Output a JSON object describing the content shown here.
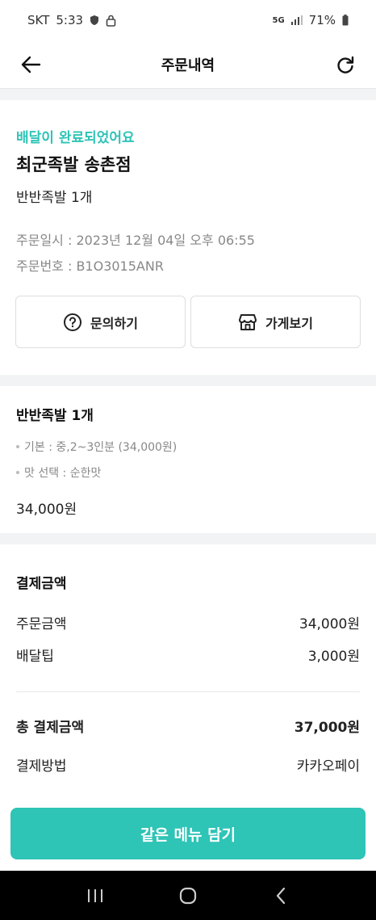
{
  "status_bar": {
    "carrier": "SKT",
    "time": "5:33",
    "network": "5G",
    "battery": "71%"
  },
  "app_bar": {
    "title": "주문내역",
    "back_icon": "arrow-left-icon",
    "refresh_icon": "refresh-icon"
  },
  "order": {
    "status_message": "배달이 완료되었어요",
    "store_name": "최군족발 송촌점",
    "menu_summary": "반반족발 1개",
    "order_date": "주문일시 : 2023년 12월 04일 오후 06:55",
    "order_number": "주문번호 : B1O3015ANR",
    "buttons": {
      "inquiry": "문의하기",
      "store": "가게보기"
    }
  },
  "item": {
    "title": "반반족발 1개",
    "options": [
      "기본 : 중,2~3인분 (34,000원)",
      "맛 선택 : 순한맛"
    ],
    "price": "34,000원"
  },
  "payment": {
    "title": "결제금액",
    "order_amount_label": "주문금액",
    "order_amount": "34,000원",
    "delivery_tip_label": "배달팁",
    "delivery_tip": "3,000원",
    "total_label": "총 결제금액",
    "total": "37,000원",
    "method_label": "결제방법",
    "method": "카카오페이"
  },
  "cta": {
    "label": "같은 메뉴 담기",
    "color": "#2ec4b6"
  },
  "nav": {
    "recent_icon": "recent-apps-icon",
    "home_icon": "home-icon",
    "back_icon": "back-icon"
  }
}
